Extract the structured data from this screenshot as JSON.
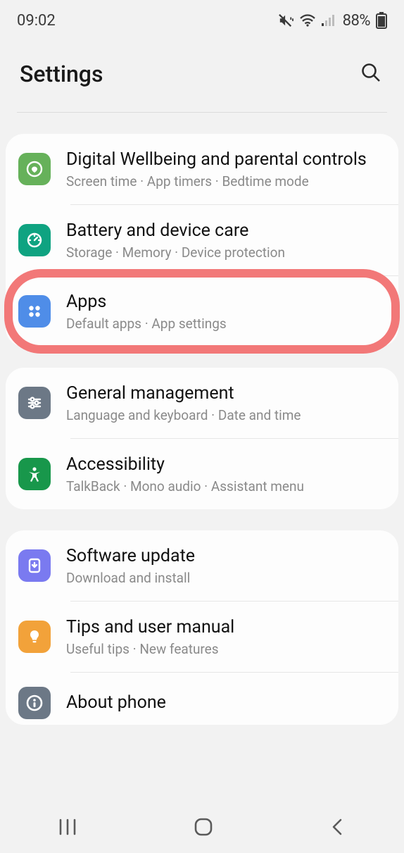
{
  "status": {
    "time": "09:02",
    "battery_pct": "88%"
  },
  "header": {
    "title": "Settings"
  },
  "groups": [
    {
      "items": [
        {
          "id": "wellbeing",
          "title": "Digital Wellbeing and parental controls",
          "sub": "Screen time  ·  App timers  ·  Bedtime mode"
        },
        {
          "id": "battery",
          "title": "Battery and device care",
          "sub": "Storage  ·  Memory  ·  Device protection"
        },
        {
          "id": "apps",
          "title": "Apps",
          "sub": "Default apps  ·  App settings"
        }
      ]
    },
    {
      "items": [
        {
          "id": "general",
          "title": "General management",
          "sub": "Language and keyboard  ·  Date and time"
        },
        {
          "id": "accessibility",
          "title": "Accessibility",
          "sub": "TalkBack  ·  Mono audio  ·  Assistant menu"
        }
      ]
    },
    {
      "items": [
        {
          "id": "update",
          "title": "Software update",
          "sub": "Download and install"
        },
        {
          "id": "tips",
          "title": "Tips and user manual",
          "sub": "Useful tips  ·  New features"
        },
        {
          "id": "about",
          "title": "About phone",
          "sub": ""
        }
      ]
    }
  ],
  "highlighted_item_id": "apps"
}
